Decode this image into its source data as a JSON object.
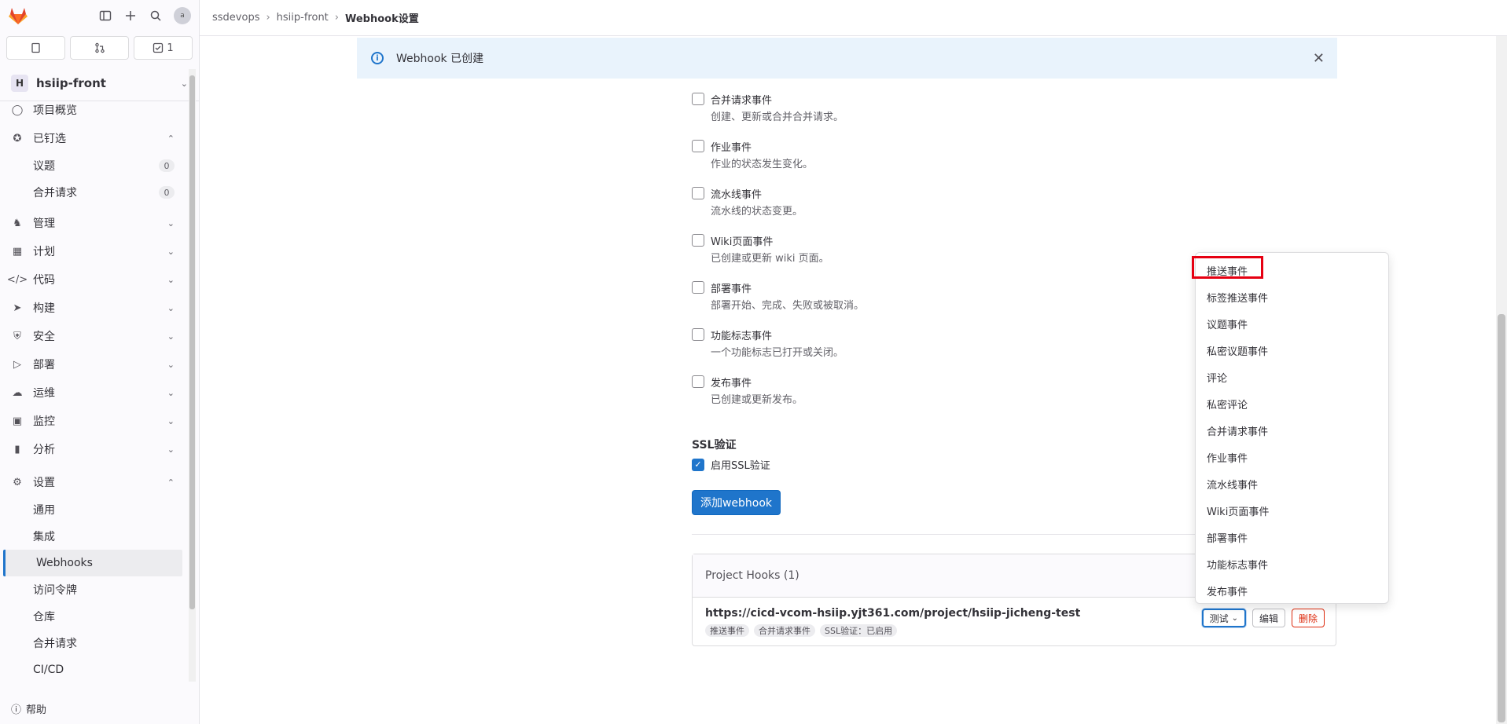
{
  "sidebar": {
    "avatar_alt": "a",
    "todo_count": "1",
    "project": {
      "initial": "H",
      "name": "hsiip-front"
    },
    "nav": [
      {
        "label": "项目概览"
      },
      {
        "label": "已钉选"
      },
      {
        "label": "议题",
        "count": "0"
      },
      {
        "label": "合并请求",
        "count": "0"
      },
      {
        "label": "管理"
      },
      {
        "label": "计划"
      },
      {
        "label": "代码"
      },
      {
        "label": "构建"
      },
      {
        "label": "安全"
      },
      {
        "label": "部署"
      },
      {
        "label": "运维"
      },
      {
        "label": "监控"
      },
      {
        "label": "分析"
      },
      {
        "label": "设置"
      },
      {
        "label": "通用"
      },
      {
        "label": "集成"
      },
      {
        "label": "Webhooks"
      },
      {
        "label": "访问令牌"
      },
      {
        "label": "仓库"
      },
      {
        "label": "合并请求"
      },
      {
        "label": "CI/CD"
      }
    ],
    "help": "帮助"
  },
  "breadcrumb": {
    "items": [
      "ssdevops",
      "hsiip-front",
      "Webhook设置"
    ]
  },
  "alert": {
    "text": "Webhook 已创建"
  },
  "events": [
    {
      "title": "合并请求事件",
      "desc": "创建、更新或合并合并请求。"
    },
    {
      "title": "作业事件",
      "desc": "作业的状态发生变化。"
    },
    {
      "title": "流水线事件",
      "desc": "流水线的状态变更。"
    },
    {
      "title": "Wiki页面事件",
      "desc": "已创建或更新 wiki 页面。"
    },
    {
      "title": "部署事件",
      "desc": "部署开始、完成、失败或被取消。"
    },
    {
      "title": "功能标志事件",
      "desc": "一个功能标志已打开或关闭。"
    },
    {
      "title": "发布事件",
      "desc": "已创建或更新发布。"
    }
  ],
  "ssl": {
    "title": "SSL验证",
    "label": "启用SSL验证",
    "checked": true
  },
  "add_button": "添加webhook",
  "hooks": {
    "title": "Project Hooks (1)",
    "url": "https://cicd-vcom-hsiip.yjt361.com/project/hsiip-jicheng-test",
    "tags": [
      "推送事件",
      "合并请求事件",
      "SSL验证：已启用"
    ],
    "buttons": {
      "test": "测试",
      "edit": "编辑",
      "delete": "删除"
    }
  },
  "dropdown": {
    "items": [
      "推送事件",
      "标签推送事件",
      "议题事件",
      "私密议题事件",
      "评论",
      "私密评论",
      "合并请求事件",
      "作业事件",
      "流水线事件",
      "Wiki页面事件",
      "部署事件",
      "功能标志事件",
      "发布事件"
    ]
  },
  "colors": {
    "primary": "#1f75cb",
    "highlight": "#e60012",
    "alert_bg": "#e9f3fc",
    "danger": "#dd2b0e"
  }
}
